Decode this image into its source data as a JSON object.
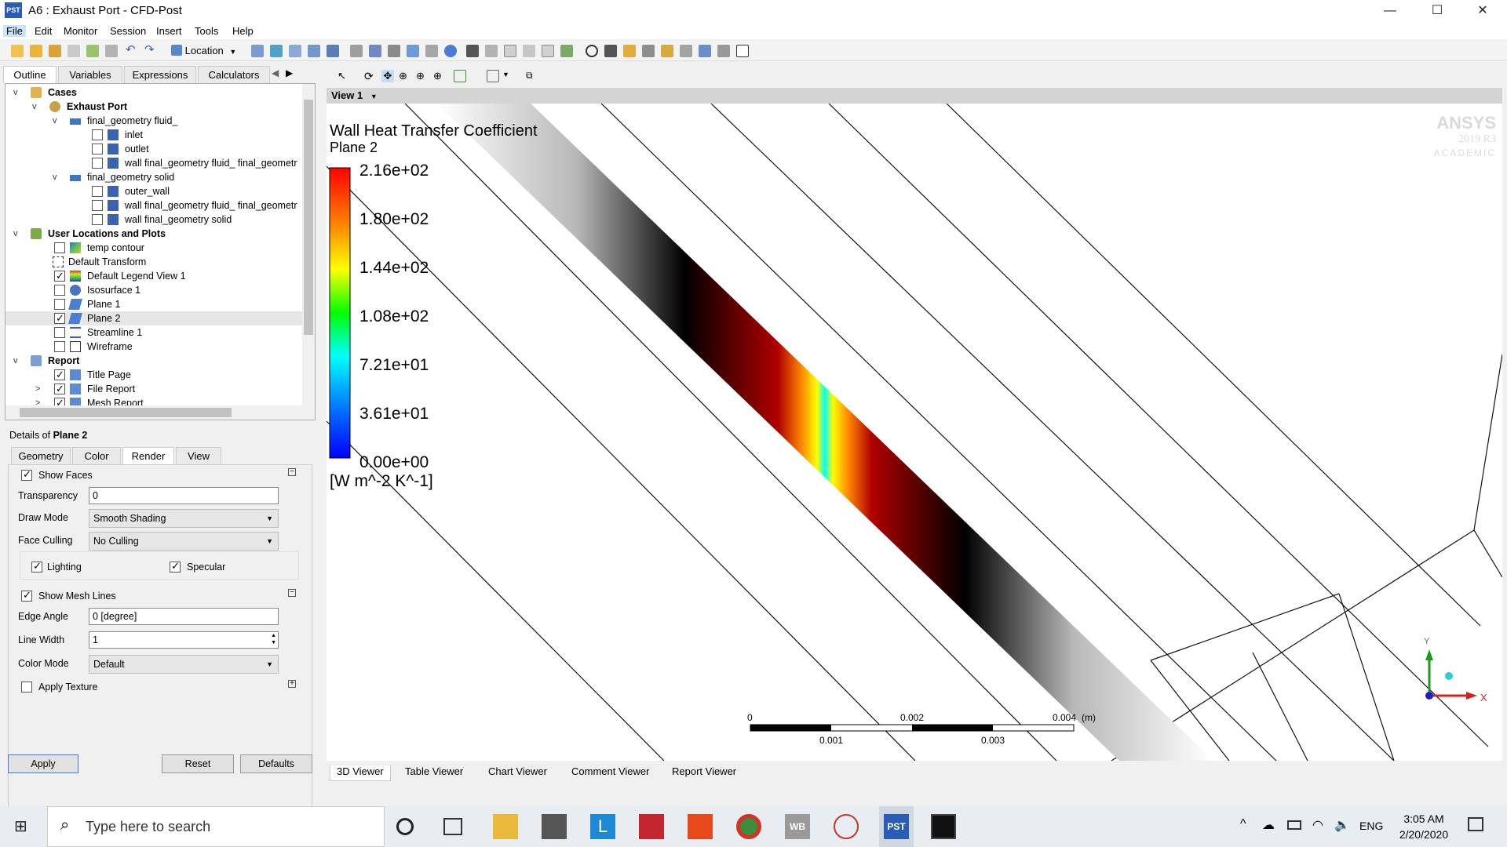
{
  "window": {
    "title": "A6 : Exhaust Port - CFD-Post",
    "app_icon_text": "PST",
    "minimize": "—",
    "maximize": "☐",
    "close": "✕"
  },
  "menu": [
    "File",
    "Edit",
    "Monitor",
    "Session",
    "Insert",
    "Tools",
    "Help"
  ],
  "toolbar": {
    "location_label": "Location"
  },
  "outline_tabs": [
    "Outline",
    "Variables",
    "Expressions",
    "Calculators"
  ],
  "tree": {
    "cases": "Cases",
    "exhaust_port": "Exhaust Port",
    "fluid": "final_geometry fluid_",
    "inlet": "inlet",
    "outlet": "outlet",
    "wall_fluid": "wall final_geometry fluid_ final_geometr",
    "solid": "final_geometry solid",
    "outer_wall": "outer_wall",
    "wall_fluid2": "wall final_geometry fluid_ final_geometr",
    "wall_solid": "wall final_geometry solid",
    "user_locations": "User Locations and Plots",
    "temp_contour": "temp contour",
    "default_transform": "Default Transform",
    "default_legend": "Default Legend View 1",
    "isosurface": "Isosurface 1",
    "plane1": "Plane 1",
    "plane2": "Plane 2",
    "streamline": "Streamline 1",
    "wireframe": "Wireframe",
    "report": "Report",
    "title_page": "Title Page",
    "file_report": "File Report",
    "mesh_report": "Mesh Report"
  },
  "details": {
    "prefix": "Details of",
    "object": "Plane 2",
    "tabs": [
      "Geometry",
      "Color",
      "Render",
      "View"
    ],
    "show_faces": "Show Faces",
    "transparency_label": "Transparency",
    "transparency_value": "0",
    "draw_mode_label": "Draw Mode",
    "draw_mode_value": "Smooth Shading",
    "face_culling_label": "Face Culling",
    "face_culling_value": "No Culling",
    "lighting": "Lighting",
    "specular": "Specular",
    "show_mesh_lines": "Show Mesh Lines",
    "edge_angle_label": "Edge Angle",
    "edge_angle_value": "0 [degree]",
    "line_width_label": "Line Width",
    "line_width_value": "1",
    "color_mode_label": "Color Mode",
    "color_mode_value": "Default",
    "apply_texture": "Apply Texture",
    "apply": "Apply",
    "reset": "Reset",
    "defaults": "Defaults"
  },
  "view": {
    "view_label": "View 1",
    "legend_title": "Wall Heat Transfer Coefficient",
    "legend_subtitle": "Plane 2",
    "legend_values": [
      "2.16e+02",
      "1.80e+02",
      "1.44e+02",
      "1.08e+02",
      "7.21e+01",
      "3.61e+01",
      "0.00e+00"
    ],
    "legend_unit": "[W m^-2 K^-1]",
    "brand": "ANSYS",
    "brand_version": "2019 R3",
    "brand_edition": "ACADEMIC",
    "scale_top": [
      "0",
      "0.002",
      "0.004",
      "(m)"
    ],
    "scale_bottom": [
      "0.001",
      "0.003"
    ],
    "axis_x": "X",
    "axis_y": "Y"
  },
  "bottom_tabs": [
    "3D Viewer",
    "Table Viewer",
    "Chart Viewer",
    "Comment Viewer",
    "Report Viewer"
  ],
  "taskbar": {
    "search_placeholder": "Type here to search",
    "lang": "ENG",
    "time": "3:05 AM",
    "date": "2/20/2020"
  }
}
